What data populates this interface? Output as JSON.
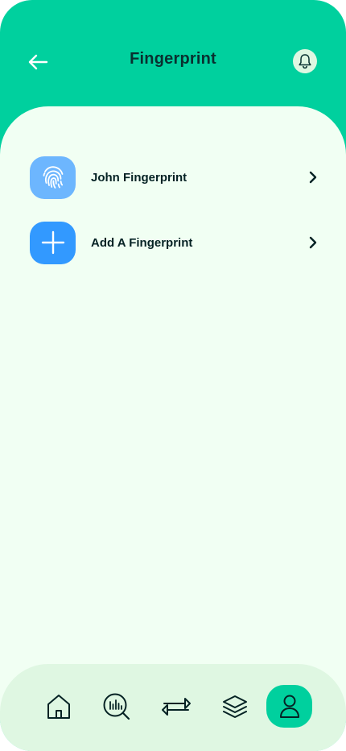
{
  "header": {
    "title": "Fingerprint",
    "back_icon": "arrow-left-icon",
    "notification_icon": "bell-icon"
  },
  "items": [
    {
      "label": "John Fingerprint",
      "icon": "fingerprint-icon",
      "icon_bg": "#6db6fe"
    },
    {
      "label": "Add A Fingerprint",
      "icon": "plus-icon",
      "icon_bg": "#3299ff"
    }
  ],
  "bottom_nav": [
    {
      "icon": "home-icon",
      "active": false
    },
    {
      "icon": "analysis-icon",
      "active": false
    },
    {
      "icon": "transactions-icon",
      "active": false
    },
    {
      "icon": "layers-icon",
      "active": false
    },
    {
      "icon": "profile-icon",
      "active": true
    }
  ],
  "colors": {
    "primary": "#00d09e",
    "background": "#f1fff3",
    "nav_background": "#dff7e2",
    "text": "#052224"
  }
}
